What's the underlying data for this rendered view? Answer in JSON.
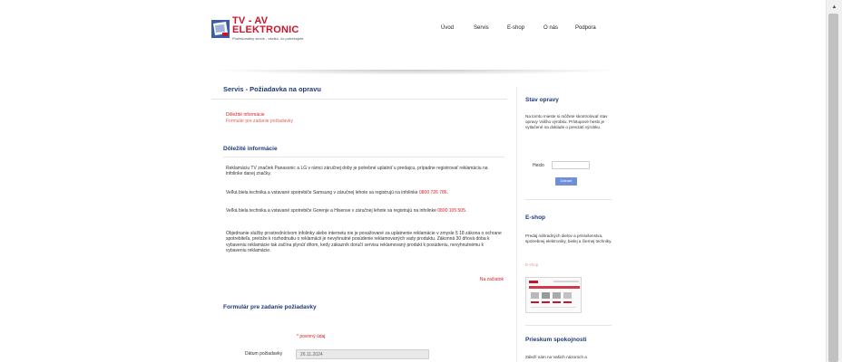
{
  "header": {
    "logo_title_line1": "TV - AV",
    "logo_title_line2": "ELEKTRONIC",
    "logo_subtitle": "Profesionálny servis - všetko, čo potrebujete",
    "nav": [
      "Úvod",
      "Servis",
      "E-shop",
      "O nás",
      "Podpora"
    ]
  },
  "main": {
    "title": "Servis - Požiadavka na opravu",
    "anchor_links": [
      "Dôležité informácie",
      "Formulár pre zadanie požiadavky"
    ],
    "info_heading": "Dôležité informácie",
    "p1": "Reklamáciu TV značiek Panasonic a LG v rámci záručnej doby je potrebné uplatniť u predajcu, prípadne registrovať reklamáciu na infolinke danej značky.",
    "p2_text": "Veľká biela technika a vstavané spotrebiče Samsung v záručnej lehote sa registrujú na infolinke ",
    "p2_phone": "0800 726 786",
    "p2_end": ".",
    "p3_text": "Veľká biela technika a vstavané spotrebiče Gorenje a Hisense v záručnej lehote sa registrujú na infolinke ",
    "p3_phone": "0800 105 505",
    "p3_end": ".",
    "p4": "Objednanie služby prostredníctvom infolinky alebo internetu nie je považované za uplatnenie reklamácie v zmysle § 18 zákona o ochrane spotrebiteľa, pretože k rozhodnutiu o reklamácii je nevyhnutné posúdenie reklamovaných vady produktu. Zákonná 30 dňová doba k vybaveniu reklamácie tak začína plynúť dňom, kedy zákazník doručí servisu reklamovaný produkt k posúdeniu, nevyhnutnému k vybaveniu reklamácie.",
    "to_top": "Na začiatok",
    "form_heading": "Formulár pre zadanie požiadavky",
    "required_note": "* povinný údaj",
    "date_label": "Dátum požiadavky",
    "date_value": "26.11.2024"
  },
  "sidebar": {
    "status_heading": "Stav opravy",
    "status_text": "Na tomto mieste si môžete skontrolovať stav opravy Vášho výrobku. Prístupové heslo je vytlačené na doklade o prevzatí výrobku.",
    "password_label": "Heslo",
    "submit_label": "Zobraziť",
    "eshop_heading": "E-shop",
    "eshop_text": "Predaj náhradných dielov a príslušenstva, spotrebnej elektroniky, bielej a čiernej techniky.",
    "eshop_link": "E-shop",
    "survey_heading": "Prieskum spokojnosti",
    "survey_text": "Záleží nám na Vašich názoroch a"
  },
  "colors": {
    "brand_red": "#c8152c",
    "heading_blue": "#1c3a7a",
    "button_blue": "#6f8fd8"
  }
}
